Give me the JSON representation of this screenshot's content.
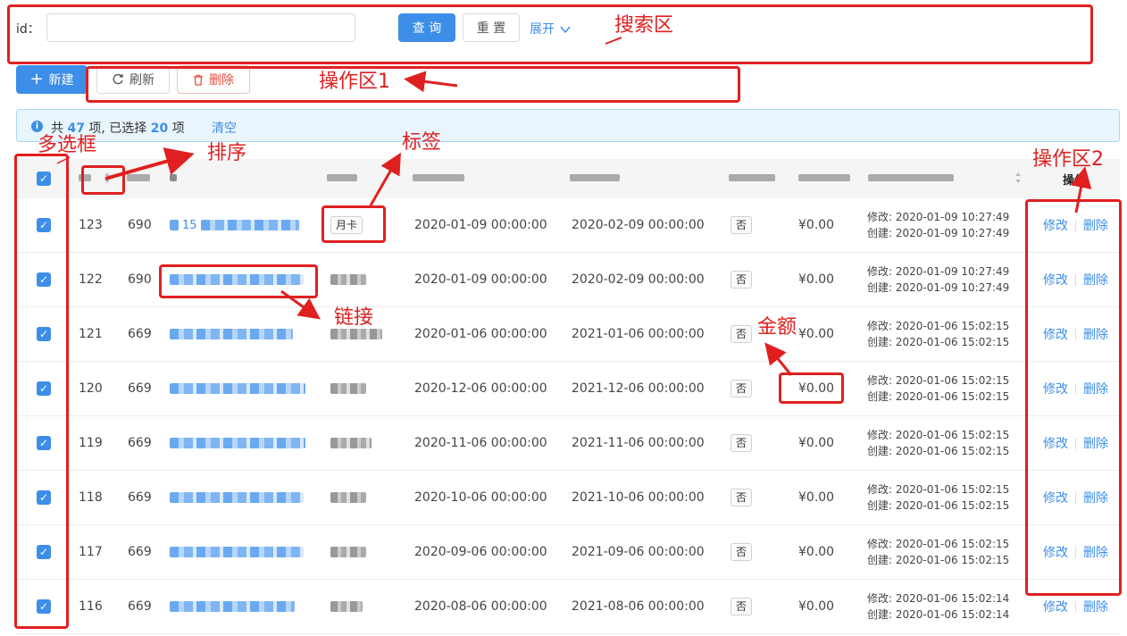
{
  "search": {
    "id_label": "id：",
    "id_value": "",
    "query_label": "查 询",
    "reset_label": "重 置",
    "expand_label": "展开"
  },
  "toolbar": {
    "new_label": "新建",
    "refresh_label": "刷新",
    "delete_label": "删除"
  },
  "alert": {
    "prefix": "共",
    "total": "47",
    "mid": "项, 已选择",
    "selected": "20",
    "suffix": "项",
    "clear_label": "清空"
  },
  "table": {
    "header_action": "操作",
    "rows": [
      {
        "id": "123",
        "user": "690",
        "link_visible": "15",
        "tag": "月卡",
        "start": "2020-01-09 00:00:00",
        "end": "2020-02-09 00:00:00",
        "flag": "否",
        "amount": "¥0.00",
        "modified": "修改: 2020-01-09 10:27:49",
        "created": "创建: 2020-01-09 10:27:49"
      },
      {
        "id": "122",
        "user": "690",
        "link_visible": "",
        "tag": "",
        "start": "2020-01-09 00:00:00",
        "end": "2020-02-09 00:00:00",
        "flag": "否",
        "amount": "¥0.00",
        "modified": "修改: 2020-01-09 10:27:49",
        "created": "创建: 2020-01-09 10:27:49"
      },
      {
        "id": "121",
        "user": "669",
        "link_visible": "",
        "tag": "",
        "start": "2020-01-06 00:00:00",
        "end": "2021-01-06 00:00:00",
        "flag": "否",
        "amount": "¥0.00",
        "modified": "修改: 2020-01-06 15:02:15",
        "created": "创建: 2020-01-06 15:02:15"
      },
      {
        "id": "120",
        "user": "669",
        "link_visible": "",
        "tag": "",
        "start": "2020-12-06 00:00:00",
        "end": "2021-12-06 00:00:00",
        "flag": "否",
        "amount": "¥0.00",
        "modified": "修改: 2020-01-06 15:02:15",
        "created": "创建: 2020-01-06 15:02:15"
      },
      {
        "id": "119",
        "user": "669",
        "link_visible": "",
        "tag": "",
        "start": "2020-11-06 00:00:00",
        "end": "2021-11-06 00:00:00",
        "flag": "否",
        "amount": "¥0.00",
        "modified": "修改: 2020-01-06 15:02:15",
        "created": "创建: 2020-01-06 15:02:15"
      },
      {
        "id": "118",
        "user": "669",
        "link_visible": "",
        "tag": "",
        "start": "2020-10-06 00:00:00",
        "end": "2021-10-06 00:00:00",
        "flag": "否",
        "amount": "¥0.00",
        "modified": "修改: 2020-01-06 15:02:15",
        "created": "创建: 2020-01-06 15:02:15"
      },
      {
        "id": "117",
        "user": "669",
        "link_visible": "",
        "tag": "",
        "start": "2020-09-06 00:00:00",
        "end": "2021-09-06 00:00:00",
        "flag": "否",
        "amount": "¥0.00",
        "modified": "修改: 2020-01-06 15:02:15",
        "created": "创建: 2020-01-06 15:02:15"
      },
      {
        "id": "116",
        "user": "669",
        "link_visible": "",
        "tag": "",
        "start": "2020-08-06 00:00:00",
        "end": "2021-08-06 00:00:00",
        "flag": "否",
        "amount": "¥0.00",
        "modified": "修改: 2020-01-06 15:02:14",
        "created": "创建: 2020-01-06 15:02:14"
      }
    ],
    "edit_label": "修改",
    "delete_label": "删除"
  },
  "annotations": {
    "search_area": "搜索区",
    "action_area_1": "操作区1",
    "multi_select": "多选框",
    "sort": "排序",
    "tag": "标签",
    "action_area_2": "操作区2",
    "link": "链接",
    "amount": "金额"
  },
  "colors": {
    "primary": "#3d8ee8",
    "annotation": "#e02020",
    "alert_bg": "#e9f5fd"
  }
}
